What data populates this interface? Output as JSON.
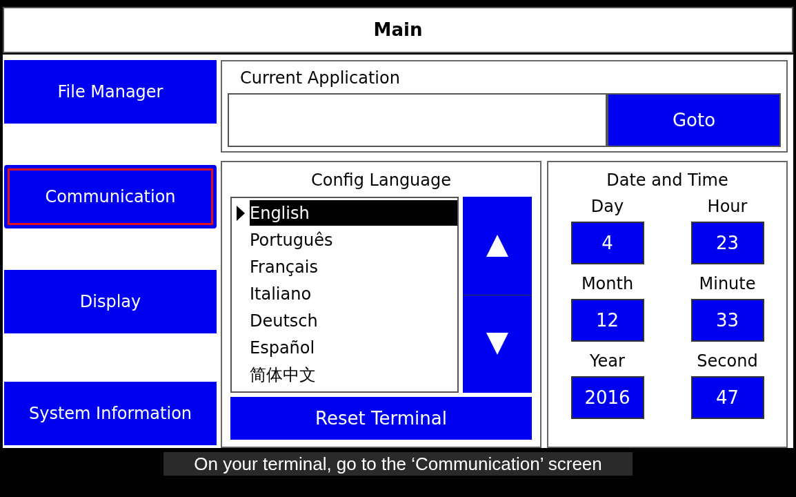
{
  "title": "Main",
  "nav": [
    {
      "label": "File Manager",
      "highlighted": false
    },
    {
      "label": "Communication",
      "highlighted": true
    },
    {
      "label": "Display",
      "highlighted": false
    },
    {
      "label": "System Information",
      "highlighted": false
    }
  ],
  "current_application": {
    "label": "Current Application",
    "button": "Goto"
  },
  "config_language": {
    "title": "Config Language",
    "items": [
      {
        "label": "English",
        "selected": true
      },
      {
        "label": "Português",
        "selected": false
      },
      {
        "label": "Français",
        "selected": false
      },
      {
        "label": "Italiano",
        "selected": false
      },
      {
        "label": "Deutsch",
        "selected": false
      },
      {
        "label": "Español",
        "selected": false
      },
      {
        "label": "简体中文",
        "selected": false
      }
    ],
    "button": "Reset Terminal"
  },
  "date_and_time": {
    "title": "Date and Time",
    "fields": [
      {
        "label": "Day",
        "value": "4"
      },
      {
        "label": "Hour",
        "value": "23"
      },
      {
        "label": "Month",
        "value": "12"
      },
      {
        "label": "Minute",
        "value": "33"
      },
      {
        "label": "Year",
        "value": "2016"
      },
      {
        "label": "Second",
        "value": "47"
      }
    ]
  },
  "subtitle": "On your terminal, go to the ‘Communication’ screen"
}
